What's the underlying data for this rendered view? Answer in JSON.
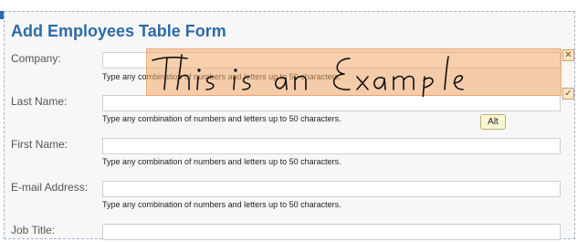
{
  "form": {
    "title": "Add Employees Table Form",
    "fields": [
      {
        "label": "Company:",
        "value": "",
        "help": "Type any combination of numbers and letters up to 50 characters."
      },
      {
        "label": "Last Name:",
        "value": "",
        "help": "Type any combination of numbers and letters up to 50 characters."
      },
      {
        "label": "First Name:",
        "value": "",
        "help": "Type any combination of numbers and letters up to 50 characters."
      },
      {
        "label": "E-mail Address:",
        "value": "",
        "help": "Type any combination of numbers and letters up to 50 characters."
      },
      {
        "label": "Job Title:",
        "value": ""
      }
    ]
  },
  "ink_overlay": {
    "handwriting": "This is an Example",
    "close_glyph": "✕",
    "accept_glyph": "✓",
    "tint_color": "#f4aa6c"
  },
  "alt_button": {
    "label": "Alt"
  }
}
